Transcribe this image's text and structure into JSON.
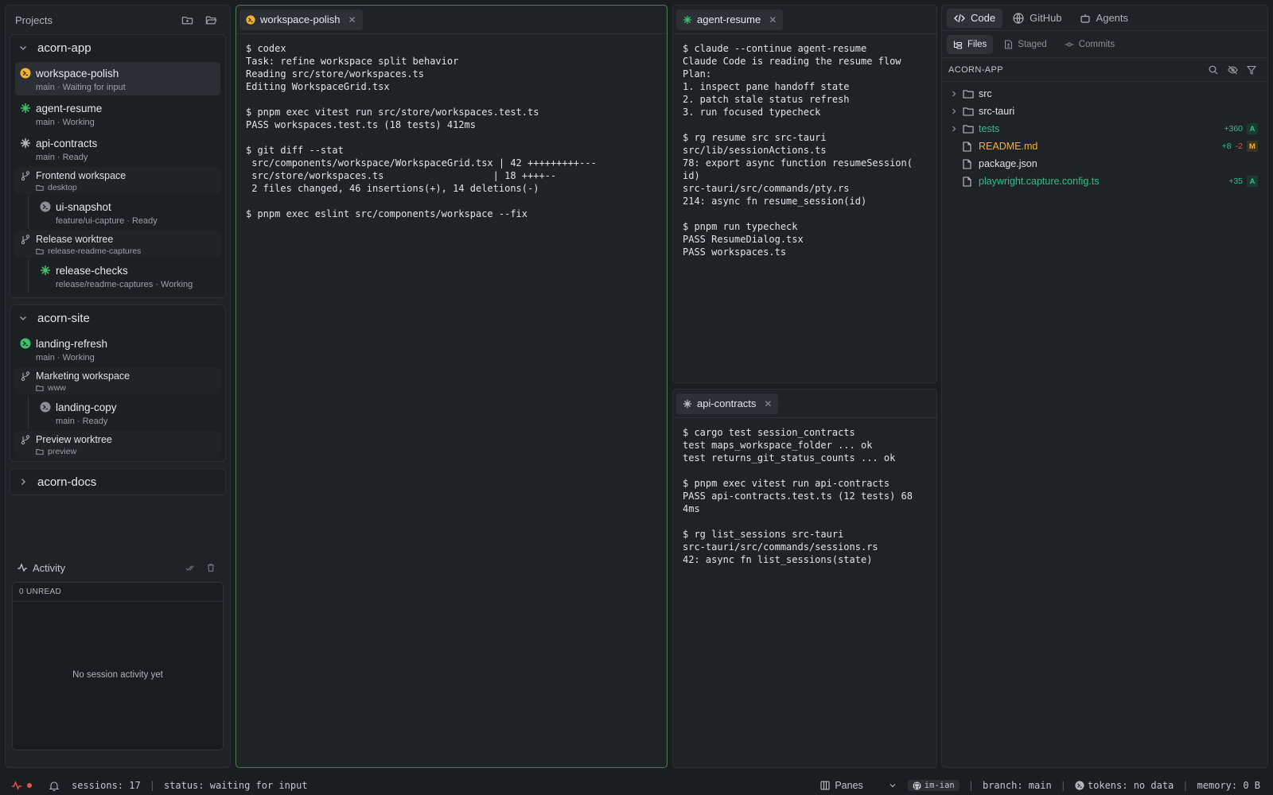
{
  "sidebar": {
    "title": "Projects",
    "projects": [
      {
        "name": "acorn-app",
        "sessions": [
          {
            "name": "workspace-polish",
            "meta": "main · Waiting for input",
            "status_color": "#f0b232"
          },
          {
            "name": "agent-resume",
            "meta": "main · Working",
            "status_color": "#3fbf6a"
          },
          {
            "name": "api-contracts",
            "meta": "main · Ready",
            "status_color": "#b8bcc1"
          }
        ],
        "workspaces": [
          {
            "name": "Frontend workspace",
            "folder": "desktop",
            "child": {
              "name": "ui-snapshot",
              "meta": "feature/ui-capture · Ready",
              "status_color": "#9aa0a6"
            }
          },
          {
            "name": "Release worktree",
            "folder": "release-readme-captures",
            "child": {
              "name": "release-checks",
              "meta": "release/readme-captures · Working",
              "status_color": "#3fbf6a"
            }
          }
        ]
      },
      {
        "name": "acorn-site",
        "sessions": [
          {
            "name": "landing-refresh",
            "meta": "main · Working",
            "status_color": "#3fbf6a"
          }
        ],
        "workspaces": [
          {
            "name": "Marketing workspace",
            "folder": "www",
            "child": {
              "name": "landing-copy",
              "meta": "main · Ready",
              "status_color": "#9aa0a6"
            }
          },
          {
            "name": "Preview worktree",
            "folder": "preview"
          }
        ]
      },
      {
        "name": "acorn-docs"
      }
    ]
  },
  "activity": {
    "title": "Activity",
    "unread": "0 UNREAD",
    "empty": "No session activity yet"
  },
  "panes": {
    "left": {
      "tab": "workspace-polish",
      "lines": [
        "$ codex",
        "Task: refine workspace split behavior",
        "Reading src/store/workspaces.ts",
        "Editing WorkspaceGrid.tsx",
        "",
        "$ pnpm exec vitest run src/store/workspaces.test.ts",
        "PASS workspaces.test.ts (18 tests) 412ms",
        "",
        "$ git diff --stat",
        " src/components/workspace/WorkspaceGrid.tsx | 42 +++++++++---",
        " src/store/workspaces.ts                   | 18 ++++--",
        " 2 files changed, 46 insertions(+), 14 deletions(-)",
        "",
        "$ pnpm exec eslint src/components/workspace --fix"
      ]
    },
    "top_right": {
      "tab": "agent-resume",
      "lines": [
        "$ claude --continue agent-resume",
        "Claude Code is reading the resume flow",
        "Plan:",
        "1. inspect pane handoff state",
        "2. patch stale status refresh",
        "3. run focused typecheck",
        "",
        "$ rg resume src src-tauri",
        "src/lib/sessionActions.ts",
        "78: export async function resumeSession(",
        "id)",
        "src-tauri/src/commands/pty.rs",
        "214: async fn resume_session(id)",
        "",
        "$ pnpm run typecheck",
        "PASS ResumeDialog.tsx",
        "PASS workspaces.ts"
      ]
    },
    "bottom_right": {
      "tab": "api-contracts",
      "lines": [
        "$ cargo test session_contracts",
        "test maps_workspace_folder ... ok",
        "test returns_git_status_counts ... ok",
        "",
        "$ pnpm exec vitest run api-contracts",
        "PASS api-contracts.test.ts (12 tests) 68",
        "4ms",
        "",
        "$ rg list_sessions src-tauri",
        "src-tauri/src/commands/sessions.rs",
        "42: async fn list_sessions(state)"
      ]
    }
  },
  "right_panel": {
    "tabs": [
      "Code",
      "GitHub",
      "Agents"
    ],
    "subtabs": [
      "Files",
      "Staged",
      "Commits"
    ],
    "repo": "ACORN-APP",
    "tree": [
      {
        "name": "src",
        "type": "folder"
      },
      {
        "name": "src-tauri",
        "type": "folder"
      },
      {
        "name": "tests",
        "type": "folder",
        "added": "+360",
        "badge": "A",
        "tone": "green"
      },
      {
        "name": "README.md",
        "type": "file",
        "added": "+8",
        "removed": "-2",
        "badge": "M",
        "tone": "amber"
      },
      {
        "name": "package.json",
        "type": "file"
      },
      {
        "name": "playwright.capture.config.ts",
        "type": "file",
        "added": "+35",
        "badge": "A",
        "tone": "green"
      }
    ]
  },
  "statusbar": {
    "sessions": "sessions: 17",
    "status": "status: waiting for input",
    "panes": "Panes",
    "github_user": "im-ian",
    "branch": "branch: main",
    "tokens": "tokens: no data",
    "memory": "memory: 0 B"
  },
  "colors": {
    "accent_green": "#27c28b",
    "modified_amber": "#f0b232",
    "deleted_red": "#e5534b",
    "focus_border": "#4f7a55"
  }
}
